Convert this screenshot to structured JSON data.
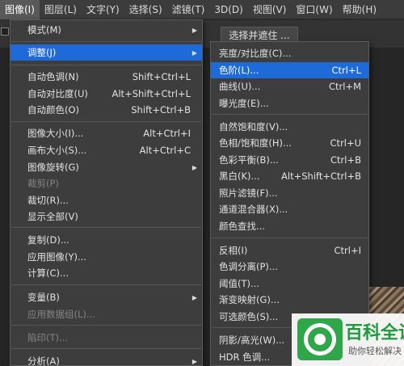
{
  "menubar": {
    "items": [
      "图像(I)",
      "图层(L)",
      "文字(Y)",
      "选择(S)",
      "滤镜(T)",
      "3D(D)",
      "视图(V)",
      "窗口(W)",
      "帮助(H)"
    ]
  },
  "options_bar": {
    "select_mask_label": "选择并遮住 ..."
  },
  "image_menu": {
    "items": [
      {
        "label": "模式(M)",
        "submenu": true
      },
      {
        "label": "调整(J)",
        "submenu": true,
        "highlighted": true
      },
      {
        "label": "自动色调(N)",
        "shortcut": "Shift+Ctrl+L"
      },
      {
        "label": "自动对比度(U)",
        "shortcut": "Alt+Shift+Ctrl+L"
      },
      {
        "label": "自动颜色(O)",
        "shortcut": "Shift+Ctrl+B"
      },
      {
        "label": "图像大小(I)...",
        "shortcut": "Alt+Ctrl+I"
      },
      {
        "label": "画布大小(S)...",
        "shortcut": "Alt+Ctrl+C"
      },
      {
        "label": "图像旋转(G)",
        "submenu": true
      },
      {
        "label": "裁剪(P)",
        "disabled": true
      },
      {
        "label": "裁切(R)..."
      },
      {
        "label": "显示全部(V)"
      },
      {
        "label": "复制(D)..."
      },
      {
        "label": "应用图像(Y)..."
      },
      {
        "label": "计算(C)..."
      },
      {
        "label": "变量(B)",
        "submenu": true
      },
      {
        "label": "应用数据组(L)...",
        "disabled": true
      },
      {
        "label": "陷印(T)...",
        "disabled": true
      },
      {
        "label": "分析(A)",
        "submenu": true
      }
    ]
  },
  "adjust_submenu": {
    "items": [
      {
        "label": "亮度/对比度(C)..."
      },
      {
        "label": "色阶(L)...",
        "shortcut": "Ctrl+L",
        "highlighted": true
      },
      {
        "label": "曲线(U)...",
        "shortcut": "Ctrl+M"
      },
      {
        "label": "曝光度(E)..."
      },
      {
        "label": "自然饱和度(V)..."
      },
      {
        "label": "色相/饱和度(H)...",
        "shortcut": "Ctrl+U"
      },
      {
        "label": "色彩平衡(B)...",
        "shortcut": "Ctrl+B"
      },
      {
        "label": "黑白(K)...",
        "shortcut": "Alt+Shift+Ctrl+B"
      },
      {
        "label": "照片滤镜(F)..."
      },
      {
        "label": "通道混合器(X)..."
      },
      {
        "label": "颜色查找..."
      },
      {
        "label": "反相(I)",
        "shortcut": "Ctrl+I"
      },
      {
        "label": "色调分离(P)..."
      },
      {
        "label": "阈值(T)..."
      },
      {
        "label": "渐变映射(G)..."
      },
      {
        "label": "可选颜色(S)..."
      },
      {
        "label": "阴影/高光(W)..."
      },
      {
        "label": "HDR 色调..."
      }
    ]
  },
  "watermark": {
    "title": "百科全说",
    "subtitle": "助你轻松解决",
    "brand_color": "#2fa64a"
  },
  "colors": {
    "menu_bg": "#3d3d3d",
    "highlight": "#1d6ad8",
    "menubar_bg": "#3c3c3c"
  }
}
